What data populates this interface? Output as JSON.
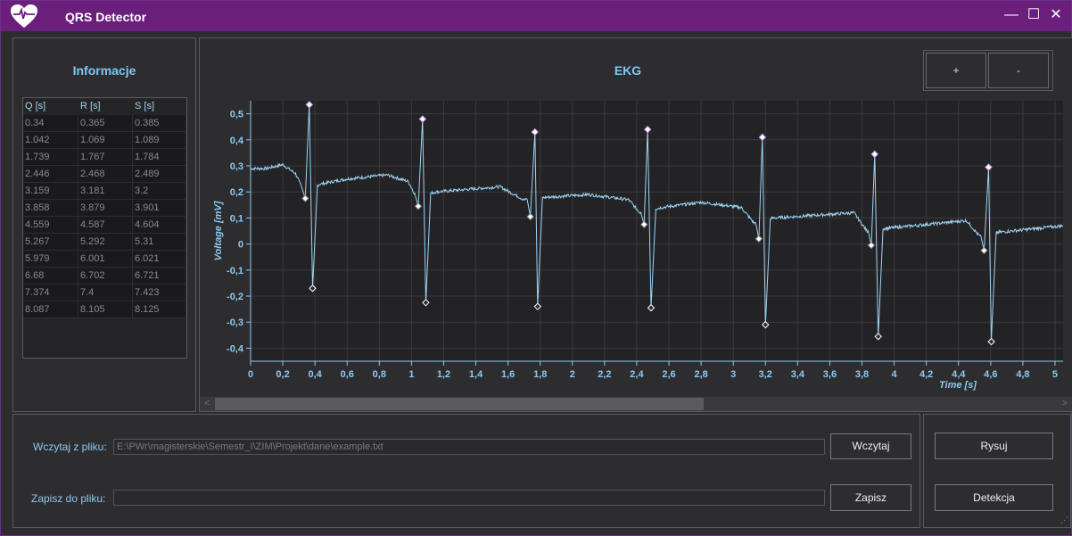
{
  "app": {
    "title": "QRS Detector",
    "minimize_glyph": "—",
    "maximize_glyph": "☐",
    "close_glyph": "✕"
  },
  "info": {
    "title": "Informacje",
    "columns": [
      "Q [s]",
      "R [s]",
      "S [s]"
    ],
    "rows": [
      [
        "0.34",
        "0.365",
        "0.385"
      ],
      [
        "1.042",
        "1.069",
        "1.089"
      ],
      [
        "1.739",
        "1.767",
        "1.784"
      ],
      [
        "2.446",
        "2.468",
        "2.489"
      ],
      [
        "3.159",
        "3.181",
        "3.2"
      ],
      [
        "3.858",
        "3.879",
        "3.901"
      ],
      [
        "4.559",
        "4.587",
        "4.604"
      ],
      [
        "5.267",
        "5.292",
        "5.31"
      ],
      [
        "5.979",
        "6.001",
        "6.021"
      ],
      [
        "6.68",
        "6.702",
        "6.721"
      ],
      [
        "7.374",
        "7.4",
        "7.423"
      ],
      [
        "8.087",
        "8.105",
        "8.125"
      ]
    ]
  },
  "ekg": {
    "title": "EKG",
    "zoom_in_label": "+",
    "zoom_out_label": "-",
    "scroll_left": "<",
    "scroll_right": ">"
  },
  "file": {
    "load_label": "Wczytaj z pliku:",
    "load_path": "E:\\PWr\\magisterskie\\Semestr_I\\ZIM\\Projekt\\dane\\example.txt",
    "load_button": "Wczytaj",
    "save_label": "Zapisz do pliku:",
    "save_path": "",
    "save_button": "Zapisz"
  },
  "actions": {
    "draw_button": "Rysuj",
    "detect_button": "Detekcja"
  },
  "colors": {
    "accent": "#6b1f7d",
    "signal": "#9fd4f7",
    "r_marker": "#c8a0f0",
    "qs_marker": "#ffffff",
    "label": "#7ec8f2"
  },
  "chart_data": {
    "type": "line",
    "xlabel": "Time [s]",
    "ylabel": "Voltage [mV]",
    "xlim": [
      0,
      5.05
    ],
    "ylim": [
      -0.45,
      0.55
    ],
    "x_ticks": [
      "0",
      "0,2",
      "0,4",
      "0,6",
      "0,8",
      "1",
      "1,2",
      "1,4",
      "1,6",
      "1,8",
      "2",
      "2,2",
      "2,4",
      "2,6",
      "2,8",
      "3",
      "3,2",
      "3,4",
      "3,6",
      "3,8",
      "4",
      "4,2",
      "4,4",
      "4,6",
      "4,8",
      "5"
    ],
    "y_ticks": [
      "0,5",
      "0,4",
      "0,3",
      "0,2",
      "0,1",
      "0",
      "-0,1",
      "-0,2",
      "-0,3",
      "-0,4"
    ],
    "grid": true,
    "r_peaks": [
      [
        0.365,
        0.535
      ],
      [
        1.069,
        0.48
      ],
      [
        1.767,
        0.43
      ],
      [
        2.468,
        0.44
      ],
      [
        3.181,
        0.41
      ],
      [
        3.879,
        0.345
      ],
      [
        4.587,
        0.295
      ]
    ],
    "q_points": [
      [
        0.34,
        0.175
      ],
      [
        1.042,
        0.145
      ],
      [
        1.739,
        0.105
      ],
      [
        2.446,
        0.075
      ],
      [
        3.159,
        0.02
      ],
      [
        3.858,
        -0.005
      ],
      [
        4.559,
        -0.025
      ]
    ],
    "s_points": [
      [
        0.385,
        -0.17
      ],
      [
        1.089,
        -0.225
      ],
      [
        1.784,
        -0.24
      ],
      [
        2.489,
        -0.245
      ],
      [
        3.2,
        -0.31
      ],
      [
        3.901,
        -0.355
      ],
      [
        4.604,
        -0.375
      ]
    ],
    "baseline": [
      [
        0,
        0.29
      ],
      [
        0.1,
        0.29
      ],
      [
        0.2,
        0.305
      ],
      [
        0.28,
        0.27
      ],
      [
        0.33,
        0.2
      ],
      [
        0.43,
        0.23
      ],
      [
        0.6,
        0.25
      ],
      [
        0.85,
        0.265
      ],
      [
        0.98,
        0.24
      ],
      [
        1.03,
        0.18
      ],
      [
        1.15,
        0.2
      ],
      [
        1.35,
        0.21
      ],
      [
        1.55,
        0.22
      ],
      [
        1.7,
        0.17
      ],
      [
        1.85,
        0.18
      ],
      [
        2.1,
        0.19
      ],
      [
        2.35,
        0.17
      ],
      [
        2.42,
        0.12
      ],
      [
        2.55,
        0.14
      ],
      [
        2.8,
        0.16
      ],
      [
        3.05,
        0.14
      ],
      [
        3.13,
        0.08
      ],
      [
        3.25,
        0.1
      ],
      [
        3.5,
        0.11
      ],
      [
        3.75,
        0.12
      ],
      [
        3.83,
        0.05
      ],
      [
        3.95,
        0.06
      ],
      [
        4.2,
        0.075
      ],
      [
        4.45,
        0.09
      ],
      [
        4.53,
        0.03
      ],
      [
        4.65,
        0.045
      ],
      [
        5.05,
        0.07
      ]
    ]
  }
}
